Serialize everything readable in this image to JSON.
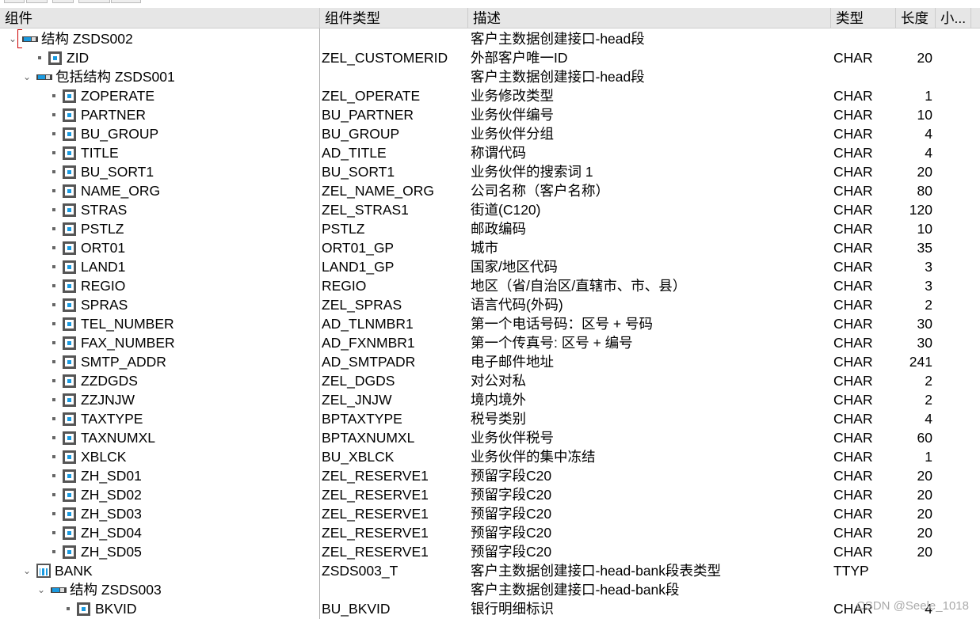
{
  "columns": [
    "组件",
    "组件类型",
    "描述",
    "类型",
    "长度",
    "小...",
    ""
  ],
  "rows": [
    {
      "level": 0,
      "kind": "struct",
      "expand": true,
      "name": "结构 ZSDS002",
      "ctype": "",
      "desc": "客户主数据创建接口-head段",
      "type": "",
      "len": ""
    },
    {
      "level": 1,
      "kind": "field",
      "name": "ZID",
      "ctype": "ZEL_CUSTOMERID",
      "desc": "外部客户唯一ID",
      "type": "CHAR",
      "len": "20"
    },
    {
      "level": 1,
      "kind": "struct",
      "expand": true,
      "name": "包括结构 ZSDS001",
      "ctype": "",
      "desc": "客户主数据创建接口-head段",
      "type": "",
      "len": ""
    },
    {
      "level": 2,
      "kind": "field",
      "name": "ZOPERATE",
      "ctype": "ZEL_OPERATE",
      "desc": "业务修改类型",
      "type": "CHAR",
      "len": "1"
    },
    {
      "level": 2,
      "kind": "field",
      "name": "PARTNER",
      "ctype": "BU_PARTNER",
      "desc": "业务伙伴编号",
      "type": "CHAR",
      "len": "10"
    },
    {
      "level": 2,
      "kind": "field",
      "name": "BU_GROUP",
      "ctype": "BU_GROUP",
      "desc": "业务伙伴分组",
      "type": "CHAR",
      "len": "4"
    },
    {
      "level": 2,
      "kind": "field",
      "name": "TITLE",
      "ctype": "AD_TITLE",
      "desc": "称谓代码",
      "type": "CHAR",
      "len": "4"
    },
    {
      "level": 2,
      "kind": "field",
      "name": "BU_SORT1",
      "ctype": "BU_SORT1",
      "desc": "业务伙伴的搜索词 1",
      "type": "CHAR",
      "len": "20"
    },
    {
      "level": 2,
      "kind": "field",
      "name": "NAME_ORG",
      "ctype": "ZEL_NAME_ORG",
      "desc": "公司名称（客户名称）",
      "type": "CHAR",
      "len": "80"
    },
    {
      "level": 2,
      "kind": "field",
      "name": "STRAS",
      "ctype": "ZEL_STRAS1",
      "desc": "街道(C120)",
      "type": "CHAR",
      "len": "120"
    },
    {
      "level": 2,
      "kind": "field",
      "name": "PSTLZ",
      "ctype": "PSTLZ",
      "desc": "邮政编码",
      "type": "CHAR",
      "len": "10"
    },
    {
      "level": 2,
      "kind": "field",
      "name": "ORT01",
      "ctype": "ORT01_GP",
      "desc": "城市",
      "type": "CHAR",
      "len": "35"
    },
    {
      "level": 2,
      "kind": "field",
      "name": "LAND1",
      "ctype": "LAND1_GP",
      "desc": "国家/地区代码",
      "type": "CHAR",
      "len": "3"
    },
    {
      "level": 2,
      "kind": "field",
      "name": "REGIO",
      "ctype": "REGIO",
      "desc": "地区（省/自治区/直辖市、市、县）",
      "type": "CHAR",
      "len": "3"
    },
    {
      "level": 2,
      "kind": "field",
      "name": "SPRAS",
      "ctype": "ZEL_SPRAS",
      "desc": "语言代码(外码)",
      "type": "CHAR",
      "len": "2"
    },
    {
      "level": 2,
      "kind": "field",
      "name": "TEL_NUMBER",
      "ctype": "AD_TLNMBR1",
      "desc": "第一个电话号码：区号 + 号码",
      "type": "CHAR",
      "len": "30"
    },
    {
      "level": 2,
      "kind": "field",
      "name": "FAX_NUMBER",
      "ctype": "AD_FXNMBR1",
      "desc": "第一个传真号: 区号 + 编号",
      "type": "CHAR",
      "len": "30"
    },
    {
      "level": 2,
      "kind": "field",
      "name": "SMTP_ADDR",
      "ctype": "AD_SMTPADR",
      "desc": "电子邮件地址",
      "type": "CHAR",
      "len": "241"
    },
    {
      "level": 2,
      "kind": "field",
      "name": "ZZDGDS",
      "ctype": "ZEL_DGDS",
      "desc": "对公对私",
      "type": "CHAR",
      "len": "2"
    },
    {
      "level": 2,
      "kind": "field",
      "name": "ZZJNJW",
      "ctype": "ZEL_JNJW",
      "desc": "境内境外",
      "type": "CHAR",
      "len": "2"
    },
    {
      "level": 2,
      "kind": "field",
      "name": "TAXTYPE",
      "ctype": "BPTAXTYPE",
      "desc": "税号类别",
      "type": "CHAR",
      "len": "4"
    },
    {
      "level": 2,
      "kind": "field",
      "name": "TAXNUMXL",
      "ctype": "BPTAXNUMXL",
      "desc": "业务伙伴税号",
      "type": "CHAR",
      "len": "60"
    },
    {
      "level": 2,
      "kind": "field",
      "name": "XBLCK",
      "ctype": "BU_XBLCK",
      "desc": "业务伙伴的集中冻结",
      "type": "CHAR",
      "len": "1"
    },
    {
      "level": 2,
      "kind": "field",
      "name": "ZH_SD01",
      "ctype": "ZEL_RESERVE1",
      "desc": "预留字段C20",
      "type": "CHAR",
      "len": "20"
    },
    {
      "level": 2,
      "kind": "field",
      "name": "ZH_SD02",
      "ctype": "ZEL_RESERVE1",
      "desc": "预留字段C20",
      "type": "CHAR",
      "len": "20"
    },
    {
      "level": 2,
      "kind": "field",
      "name": "ZH_SD03",
      "ctype": "ZEL_RESERVE1",
      "desc": "预留字段C20",
      "type": "CHAR",
      "len": "20"
    },
    {
      "level": 2,
      "kind": "field",
      "name": "ZH_SD04",
      "ctype": "ZEL_RESERVE1",
      "desc": "预留字段C20",
      "type": "CHAR",
      "len": "20"
    },
    {
      "level": 2,
      "kind": "field",
      "name": "ZH_SD05",
      "ctype": "ZEL_RESERVE1",
      "desc": "预留字段C20",
      "type": "CHAR",
      "len": "20"
    },
    {
      "level": 1,
      "kind": "table",
      "expand": true,
      "name": "BANK",
      "ctype": "ZSDS003_T",
      "desc": "客户主数据创建接口-head-bank段表类型",
      "type": "TTYP",
      "len": ""
    },
    {
      "level": 2,
      "kind": "struct",
      "expand": true,
      "name": "结构 ZSDS003",
      "ctype": "",
      "desc": "客户主数据创建接口-head-bank段",
      "type": "",
      "len": ""
    },
    {
      "level": 3,
      "kind": "field",
      "name": "BKVID",
      "ctype": "BU_BKVID",
      "desc": "银行明细标识",
      "type": "CHAR",
      "len": "4"
    }
  ],
  "watermark": "CSDN @Seele_1018"
}
